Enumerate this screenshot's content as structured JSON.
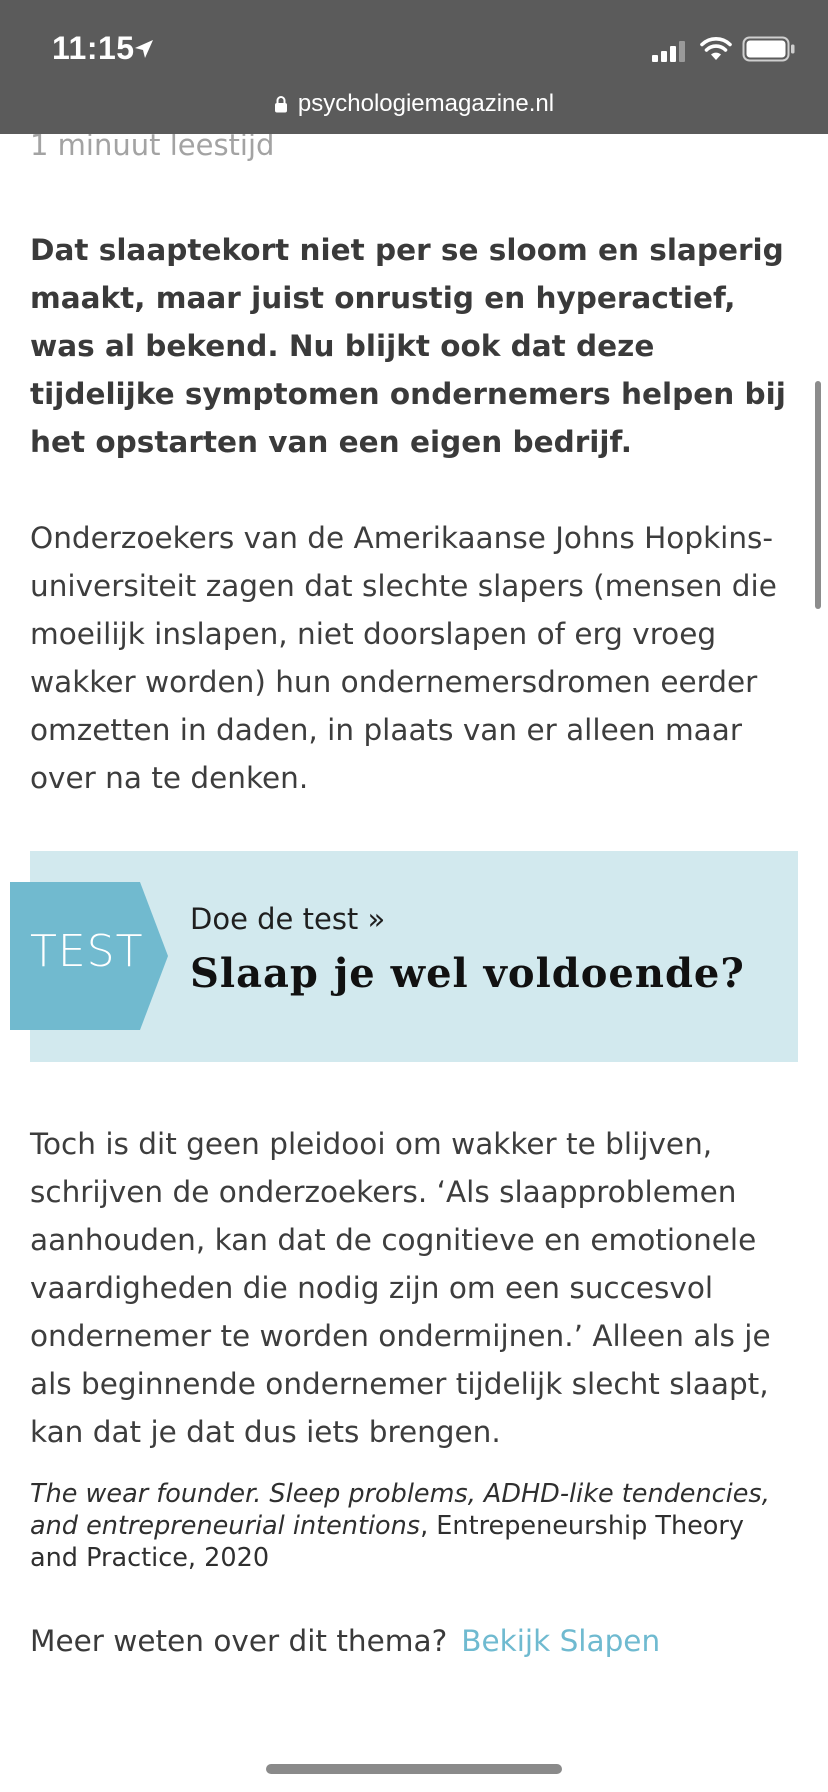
{
  "status_bar": {
    "time": "11:15",
    "icons": [
      "location-arrow-icon",
      "signal-icon",
      "wifi-icon",
      "battery-icon"
    ]
  },
  "url_bar": {
    "lock_icon": "lock-icon",
    "domain": "psychologiemagazine.nl"
  },
  "article": {
    "reading_time": "1 minuut leestijd",
    "lead": "Dat slaaptekort niet per se sloom en slaperig maakt, maar juist onrustig en hyperactief, was al bekend. Nu blijkt ook dat deze tijdelijke symptomen ondernemers helpen bij het opstarten van een eigen bedrijf.",
    "paragraph_1": "Onderzoekers van de Amerikaanse Johns Hopkins-universiteit zagen dat slechte slapers (mensen die moeilijk inslapen, niet doorslapen of erg vroeg wakker worden) hun ondernemersdromen eerder omzetten in daden, in plaats van er alleen maar over na te denken.",
    "test_teaser": {
      "tag": "TEST",
      "kicker": "Doe de test »",
      "title": "Slaap je wel voldoende?"
    },
    "paragraph_2": "Toch is dit geen pleidooi om wakker te blijven, schrijven de onderzoekers. ‘Als slaapproblemen aanhouden, kan dat de cognitieve en emotionele vaardigheden die nodig zijn om een succesvol ondernemer te worden ondermijnen.’ Alleen als je als beginnende ondernemer tijdelijk slecht slaapt, kan dat je dat dus iets brengen.",
    "citation": {
      "title": "The wear founder. Sleep problems, ADHD-like tendencies, and entrepreneurial intentions",
      "source": ", Entrepeneurship Theory and Practice, 2020"
    },
    "more": {
      "prompt": "Meer weten over dit thema?",
      "link_label": "Bekijk Slapen"
    }
  },
  "colors": {
    "chrome_bg": "#5b5b5b",
    "teaser_bg": "#d2e9ee",
    "teaser_tag": "#71bacf",
    "link": "#6fbad0"
  }
}
